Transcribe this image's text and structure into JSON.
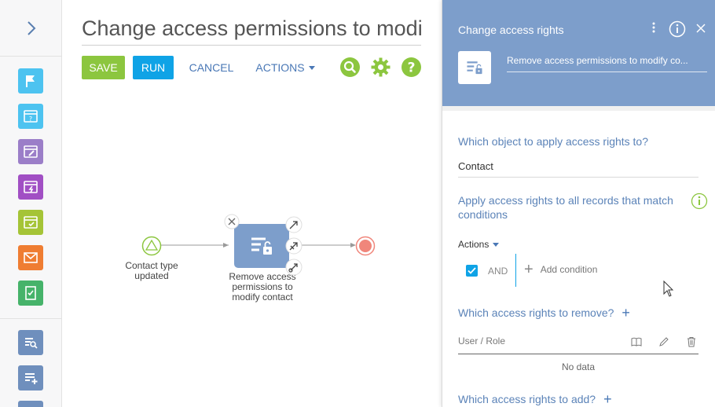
{
  "page": {
    "title": "Change access permissions to modify contact"
  },
  "toolbar": {
    "save_label": "SAVE",
    "run_label": "RUN",
    "cancel_label": "CANCEL",
    "actions_label": "ACTIONS"
  },
  "leftbar": {
    "tools": [
      {
        "name": "signal-start-icon",
        "color": "#4dc3f0"
      },
      {
        "name": "user-dialog-icon",
        "color": "#4dc3f0"
      },
      {
        "name": "edit-page-icon",
        "color": "#9b7ec8"
      },
      {
        "name": "auto-generated-page-icon",
        "color": "#a14fc4"
      },
      {
        "name": "open-edit-page-icon",
        "color": "#a5c437"
      },
      {
        "name": "send-email-icon",
        "color": "#ef7d32"
      },
      {
        "name": "perform-task-icon",
        "color": "#46b36a"
      },
      {
        "name": "read-data-icon",
        "color": "#6f8fbd"
      },
      {
        "name": "add-data-icon",
        "color": "#6f8fbd"
      }
    ]
  },
  "flow": {
    "start_label": "Contact type updated",
    "task_label": "Remove access permissions to modify contact"
  },
  "panel": {
    "title": "Change access rights",
    "element_name": "Remove access permissions to modify co...",
    "q_object": "Which object to apply access rights to?",
    "object_value": "Contact",
    "q_conditions": "Apply access rights to all records that match conditions",
    "actions_label": "Actions",
    "and_label": "AND",
    "add_condition_label": "Add condition",
    "q_remove": "Which access rights to remove?",
    "col_user_role": "User / Role",
    "no_data": "No data",
    "q_add": "Which access rights to add?"
  },
  "colors": {
    "accent": "#4a78b6",
    "panel_header": "#7d9ecb",
    "save": "#8cc63f",
    "run": "#0fa3e6"
  }
}
